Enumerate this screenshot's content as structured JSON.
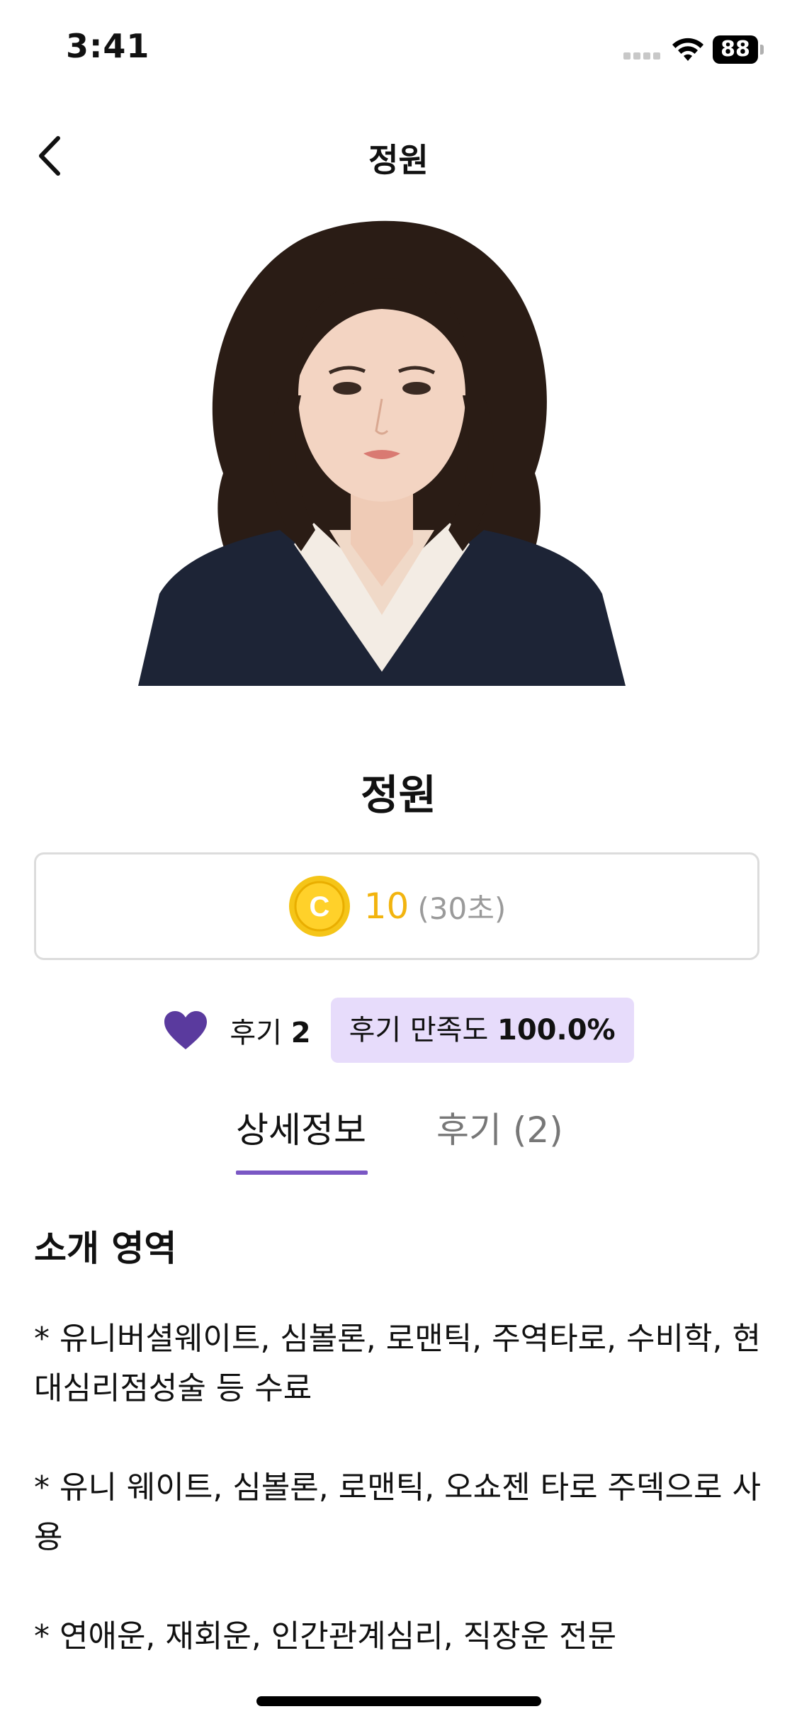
{
  "status_bar": {
    "time": "3:41",
    "battery": "88",
    "icons": [
      "signal-dots-icon",
      "wifi-icon",
      "battery-icon"
    ]
  },
  "nav": {
    "title": "정원",
    "back_icon": "chevron-left-icon"
  },
  "profile": {
    "name": "정원",
    "photo": "portrait-photo"
  },
  "price": {
    "coin_letter": "C",
    "value": "10",
    "unit": "(30초)",
    "coin_color": "#f5c518",
    "value_color": "#f2b40f"
  },
  "stats": {
    "heart_color": "#5a3a9e",
    "review_label": "후기",
    "review_count": "2",
    "satisfaction_label": "후기 만족도",
    "satisfaction_value": "100.0%",
    "badge_color": "#e7dcfb"
  },
  "tabs": [
    {
      "label": "상세정보",
      "active": true
    },
    {
      "label": "후기 (2)",
      "active": false
    }
  ],
  "accent_color": "#7a57c4",
  "intro": {
    "title": "소개 영역",
    "body": "* 유니버셜웨이트, 심볼론, 로맨틱, 주역타로, 수비학, 현대심리점성술 등 수료\n\n* 유니 웨이트, 심볼론, 로맨틱, 오쇼젠 타로 주덱으로 사용\n\n* 연애운, 재회운, 인간관계심리, 직장운 전문"
  }
}
